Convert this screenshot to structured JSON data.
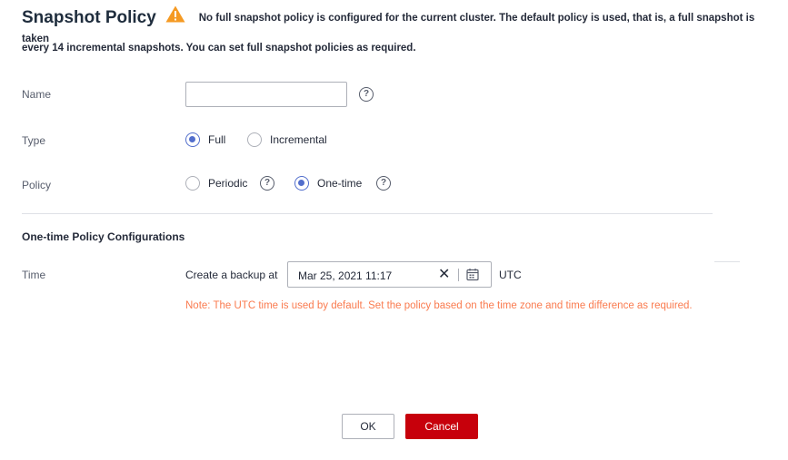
{
  "header": {
    "title": "Snapshot Policy",
    "warning_icon": "warning-triangle-icon",
    "warning_color": "#f59a23",
    "notice_line1": "No full snapshot policy is configured for the current cluster. The default policy is used, that is, a full snapshot is taken",
    "notice_line2": "every 14 incremental snapshots. You can set full snapshot policies as required."
  },
  "form": {
    "name": {
      "label": "Name",
      "value": "",
      "help_icon": "question-circle-icon"
    },
    "type": {
      "label": "Type",
      "options": [
        {
          "label": "Full",
          "checked": true
        },
        {
          "label": "Incremental",
          "checked": false
        }
      ]
    },
    "policy": {
      "label": "Policy",
      "options": [
        {
          "label": "Periodic",
          "checked": false
        },
        {
          "label": "One-time",
          "checked": true
        }
      ]
    }
  },
  "one_time": {
    "section_title": "One-time Policy Configurations",
    "time_label": "Time",
    "prefix": "Create a backup at",
    "datetime_value": "Mar 25, 2021 11:17",
    "timezone": "UTC",
    "note": "Note: The UTC time is used by default. Set the policy based on the time zone and time difference as required."
  },
  "actions": {
    "ok": "OK",
    "cancel": "Cancel"
  },
  "colors": {
    "accent": "#526ecc",
    "danger": "#c7000b",
    "note": "#fa7b4f"
  }
}
